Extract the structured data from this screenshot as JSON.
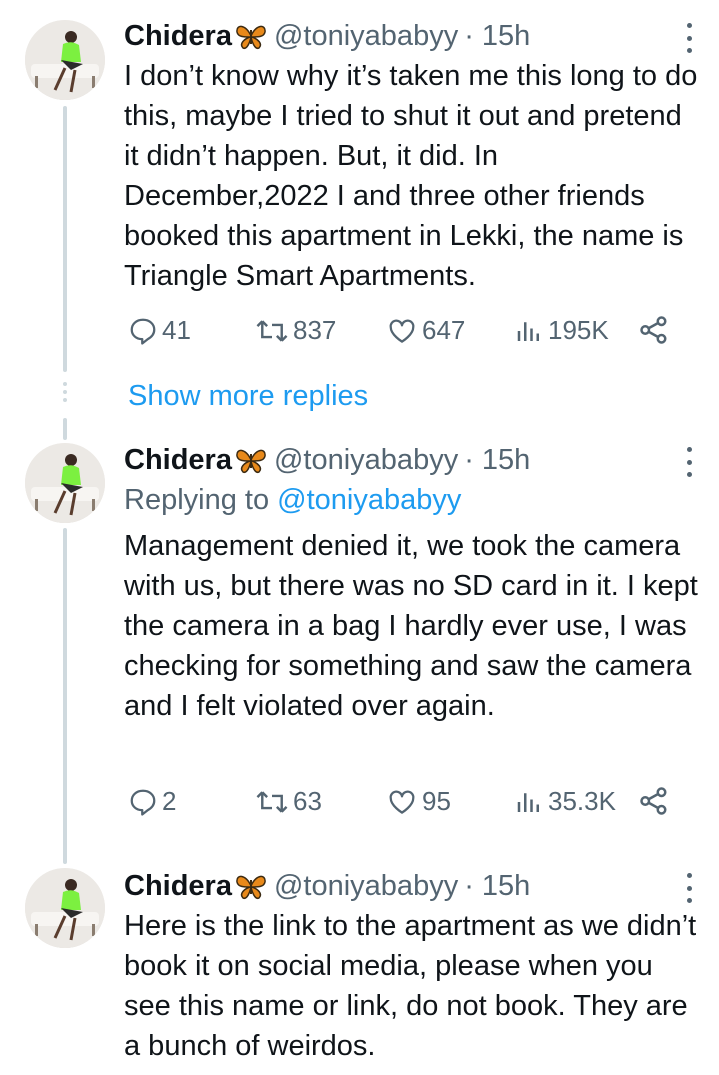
{
  "tweets": [
    {
      "author_name": "Chidera",
      "author_emoji_icon": "butterfly-icon",
      "handle": "@toniyababyy",
      "time": "· 15h",
      "text": "I don’t know why it’s taken me this long to do this, maybe I tried to shut it out and pretend it didn’t happen. But, it did. In December,2022 I and three other friends booked this apartment in Lekki, the name is Triangle Smart Apartments.",
      "stats": {
        "replies": "41",
        "retweets": "837",
        "likes": "647",
        "views": "195K"
      }
    },
    {
      "author_name": "Chidera",
      "author_emoji_icon": "butterfly-icon",
      "handle": "@toniyababyy",
      "time": "· 15h",
      "replying_prefix": "Replying to",
      "replying_handle": "@toniyababyy",
      "text": "Management denied it, we took the camera with us, but there was no SD card in it. I kept the camera in a bag I hardly ever use, I was checking for something and saw the camera and I felt violated over again.",
      "stats": {
        "replies": "2",
        "retweets": "63",
        "likes": "95",
        "views": "35.3K"
      }
    },
    {
      "author_name": "Chidera",
      "author_emoji_icon": "butterfly-icon",
      "handle": "@toniyababyy",
      "time": "· 15h",
      "text": "Here is the link to the apartment as we didn’t book it on social media, please when you see this name or link, do not book. They are a bunch of weirdos."
    }
  ],
  "show_more_replies": "Show more replies",
  "colors": {
    "link": "#1d9bf0",
    "secondary": "#536471",
    "text": "#0f1419",
    "line": "#cfd9de",
    "shirt": "#7cf040"
  }
}
